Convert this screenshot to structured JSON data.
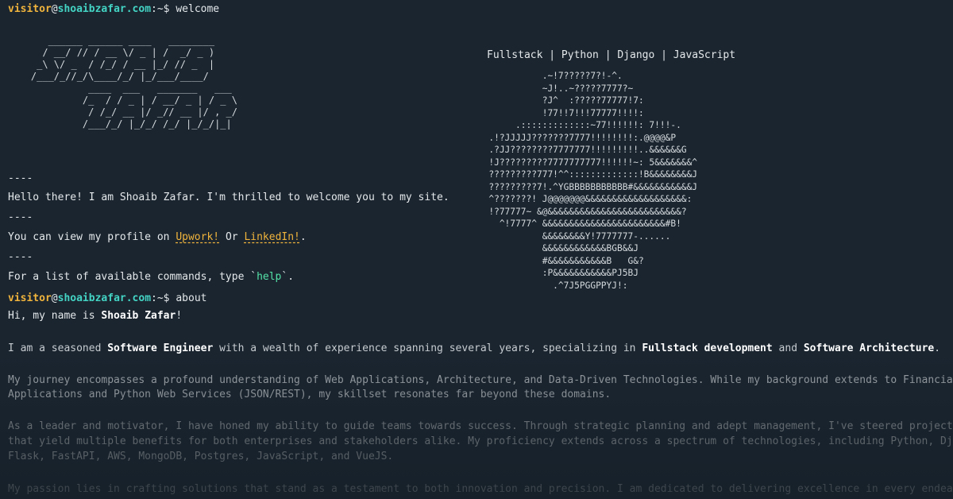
{
  "prompt": {
    "user": "visitor",
    "at": "@",
    "host": "shoaibzafar.com",
    "path": ":~$"
  },
  "commands": {
    "first": "welcome",
    "second": "about"
  },
  "welcome": {
    "separator": "----",
    "greeting": "Hello there! I am Shoaib Zafar. I'm thrilled to welcome you to my site.",
    "profile_prefix": "You can view my profile on ",
    "upwork": "Upwork!",
    "or": " Or ",
    "linkedin": "LinkedIn!",
    "profile_suffix": ".",
    "help_prefix": "For a list of available commands, type `",
    "help_kw": "help",
    "help_suffix": "`."
  },
  "banner": {
    "logo_art": "       ______ ______ ____   ________\n      / __/ // / __ \\/ _ | /  _/ _ )\n     _\\ \\/ _  / /_/ / __ |_/ // _  |\n    /___/_//_/\\____/_/ |_/___/____/\n              ____  ___   _______   ___\n             /_  / / _ | / __/ _ | / _ \\\n              / /_/ __ |/ _// __ |/ , _/\n             /___/_/ |_/_/ /_/ |_/_/|_|",
    "tagline": "Fullstack | Python | Django | JavaScript",
    "portrait_art": "                    .~!7?????7?!-^.\n                    ~J!..~?????7777?~\n                    ?J^  :?????77777!7:\n                    !77!!7!!!77777!!!!:\n               .:::::::::::::~77!!!!!!: 7!!!-.\n          .!?JJJJJ???????7777!!!!!!!!:.@@@@&P\n          .?JJ????????7777777!!!!!!!!!..&&&&&&G\n          !J?????????7777777777!!!!!!~: 5&&&&&&&^\n          ?????????777!^^:::::::::::::!B&&&&&&&&J\n          ?????????7!.^YGBBBBBBBBBBB#&&&&&&&&&&&J\n          ^???????! J@@@@@@@&&&&&&&&&&&&&&&&&&&:\n          !?77777~ &@&&&&&&&&&&&&&&&&&&&&&&&&&?\n            ^!7777^ &&&&&&&&&&&&&&&&&&&&&&&#B!\n                    &&&&&&&&Y!7777777-......\n                    &&&&&&&&&&&&BGB&&J\n                    #&&&&&&&&&&&B   G&?\n                    :P&&&&&&&&&&&PJ5BJ\n                      .^7J5PGGPPYJ!:"
  },
  "about": {
    "intro_prefix": "Hi, my name is ",
    "name": "Shoaib Zafar",
    "intro_suffix": "!",
    "p1_a": "I am a seasoned ",
    "p1_b": "Software Engineer",
    "p1_c": " with a wealth of experience spanning several years, specializing in ",
    "p1_d": "Fullstack development",
    "p1_e": " and ",
    "p1_f": "Software Architecture",
    "p1_g": ".",
    "p2_l1": "My journey encompasses a profound understanding of Web Applications, Architecture, and Data-Driven Technologies. While my background extends to Financial",
    "p2_l2": "Applications and Python Web Services (JSON/REST), my skillset resonates far beyond these domains.",
    "p3_l1": "As a leader and motivator, I have honed my ability to guide teams towards success. Through strategic planning and adept management, I've steered projects",
    "p3_l2": "that yield multiple benefits for both enterprises and stakeholders alike. My proficiency extends across a spectrum of technologies, including Python, Django,",
    "p3_l3": "Flask, FastAPI, AWS, MongoDB, Postgres, JavaScript, and VueJS.",
    "p4_l1": "My passion lies in crafting solutions that stand as a testament to both innovation and precision. I am dedicated to delivering excellence in every endeavor I"
  },
  "colors": {
    "background": "#1a2530",
    "user": "#f0b43c",
    "host": "#44d4c4",
    "link": "#f0b43c",
    "keyword": "#55e3a8"
  }
}
